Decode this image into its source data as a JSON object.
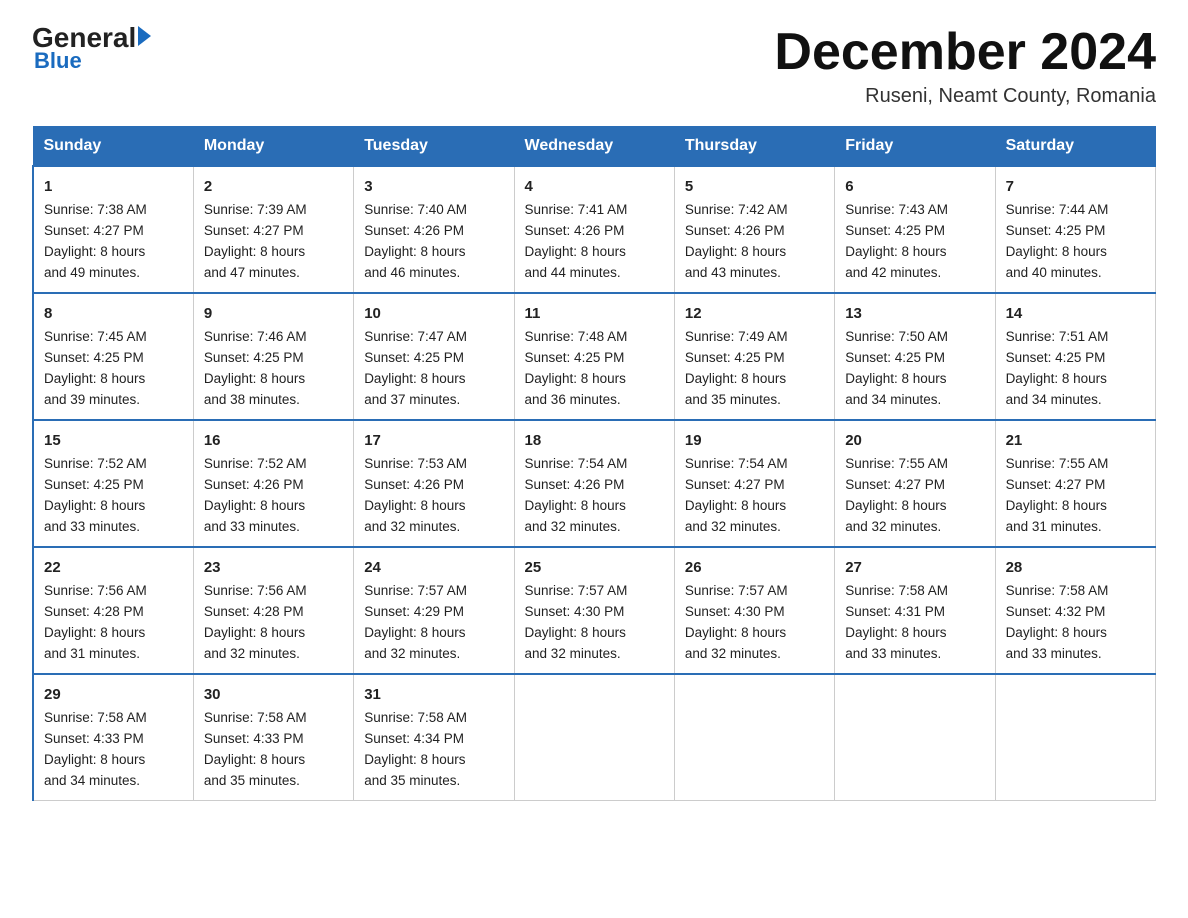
{
  "header": {
    "logo_main": "General",
    "logo_sub": "Blue",
    "month_title": "December 2024",
    "location": "Ruseni, Neamt County, Romania"
  },
  "days_of_week": [
    "Sunday",
    "Monday",
    "Tuesday",
    "Wednesday",
    "Thursday",
    "Friday",
    "Saturday"
  ],
  "weeks": [
    [
      {
        "day": "1",
        "sunrise": "7:38 AM",
        "sunset": "4:27 PM",
        "daylight": "8 hours and 49 minutes."
      },
      {
        "day": "2",
        "sunrise": "7:39 AM",
        "sunset": "4:27 PM",
        "daylight": "8 hours and 47 minutes."
      },
      {
        "day": "3",
        "sunrise": "7:40 AM",
        "sunset": "4:26 PM",
        "daylight": "8 hours and 46 minutes."
      },
      {
        "day": "4",
        "sunrise": "7:41 AM",
        "sunset": "4:26 PM",
        "daylight": "8 hours and 44 minutes."
      },
      {
        "day": "5",
        "sunrise": "7:42 AM",
        "sunset": "4:26 PM",
        "daylight": "8 hours and 43 minutes."
      },
      {
        "day": "6",
        "sunrise": "7:43 AM",
        "sunset": "4:25 PM",
        "daylight": "8 hours and 42 minutes."
      },
      {
        "day": "7",
        "sunrise": "7:44 AM",
        "sunset": "4:25 PM",
        "daylight": "8 hours and 40 minutes."
      }
    ],
    [
      {
        "day": "8",
        "sunrise": "7:45 AM",
        "sunset": "4:25 PM",
        "daylight": "8 hours and 39 minutes."
      },
      {
        "day": "9",
        "sunrise": "7:46 AM",
        "sunset": "4:25 PM",
        "daylight": "8 hours and 38 minutes."
      },
      {
        "day": "10",
        "sunrise": "7:47 AM",
        "sunset": "4:25 PM",
        "daylight": "8 hours and 37 minutes."
      },
      {
        "day": "11",
        "sunrise": "7:48 AM",
        "sunset": "4:25 PM",
        "daylight": "8 hours and 36 minutes."
      },
      {
        "day": "12",
        "sunrise": "7:49 AM",
        "sunset": "4:25 PM",
        "daylight": "8 hours and 35 minutes."
      },
      {
        "day": "13",
        "sunrise": "7:50 AM",
        "sunset": "4:25 PM",
        "daylight": "8 hours and 34 minutes."
      },
      {
        "day": "14",
        "sunrise": "7:51 AM",
        "sunset": "4:25 PM",
        "daylight": "8 hours and 34 minutes."
      }
    ],
    [
      {
        "day": "15",
        "sunrise": "7:52 AM",
        "sunset": "4:25 PM",
        "daylight": "8 hours and 33 minutes."
      },
      {
        "day": "16",
        "sunrise": "7:52 AM",
        "sunset": "4:26 PM",
        "daylight": "8 hours and 33 minutes."
      },
      {
        "day": "17",
        "sunrise": "7:53 AM",
        "sunset": "4:26 PM",
        "daylight": "8 hours and 32 minutes."
      },
      {
        "day": "18",
        "sunrise": "7:54 AM",
        "sunset": "4:26 PM",
        "daylight": "8 hours and 32 minutes."
      },
      {
        "day": "19",
        "sunrise": "7:54 AM",
        "sunset": "4:27 PM",
        "daylight": "8 hours and 32 minutes."
      },
      {
        "day": "20",
        "sunrise": "7:55 AM",
        "sunset": "4:27 PM",
        "daylight": "8 hours and 32 minutes."
      },
      {
        "day": "21",
        "sunrise": "7:55 AM",
        "sunset": "4:27 PM",
        "daylight": "8 hours and 31 minutes."
      }
    ],
    [
      {
        "day": "22",
        "sunrise": "7:56 AM",
        "sunset": "4:28 PM",
        "daylight": "8 hours and 31 minutes."
      },
      {
        "day": "23",
        "sunrise": "7:56 AM",
        "sunset": "4:28 PM",
        "daylight": "8 hours and 32 minutes."
      },
      {
        "day": "24",
        "sunrise": "7:57 AM",
        "sunset": "4:29 PM",
        "daylight": "8 hours and 32 minutes."
      },
      {
        "day": "25",
        "sunrise": "7:57 AM",
        "sunset": "4:30 PM",
        "daylight": "8 hours and 32 minutes."
      },
      {
        "day": "26",
        "sunrise": "7:57 AM",
        "sunset": "4:30 PM",
        "daylight": "8 hours and 32 minutes."
      },
      {
        "day": "27",
        "sunrise": "7:58 AM",
        "sunset": "4:31 PM",
        "daylight": "8 hours and 33 minutes."
      },
      {
        "day": "28",
        "sunrise": "7:58 AM",
        "sunset": "4:32 PM",
        "daylight": "8 hours and 33 minutes."
      }
    ],
    [
      {
        "day": "29",
        "sunrise": "7:58 AM",
        "sunset": "4:33 PM",
        "daylight": "8 hours and 34 minutes."
      },
      {
        "day": "30",
        "sunrise": "7:58 AM",
        "sunset": "4:33 PM",
        "daylight": "8 hours and 35 minutes."
      },
      {
        "day": "31",
        "sunrise": "7:58 AM",
        "sunset": "4:34 PM",
        "daylight": "8 hours and 35 minutes."
      },
      null,
      null,
      null,
      null
    ]
  ],
  "labels": {
    "sunrise": "Sunrise:",
    "sunset": "Sunset:",
    "daylight": "Daylight:"
  }
}
